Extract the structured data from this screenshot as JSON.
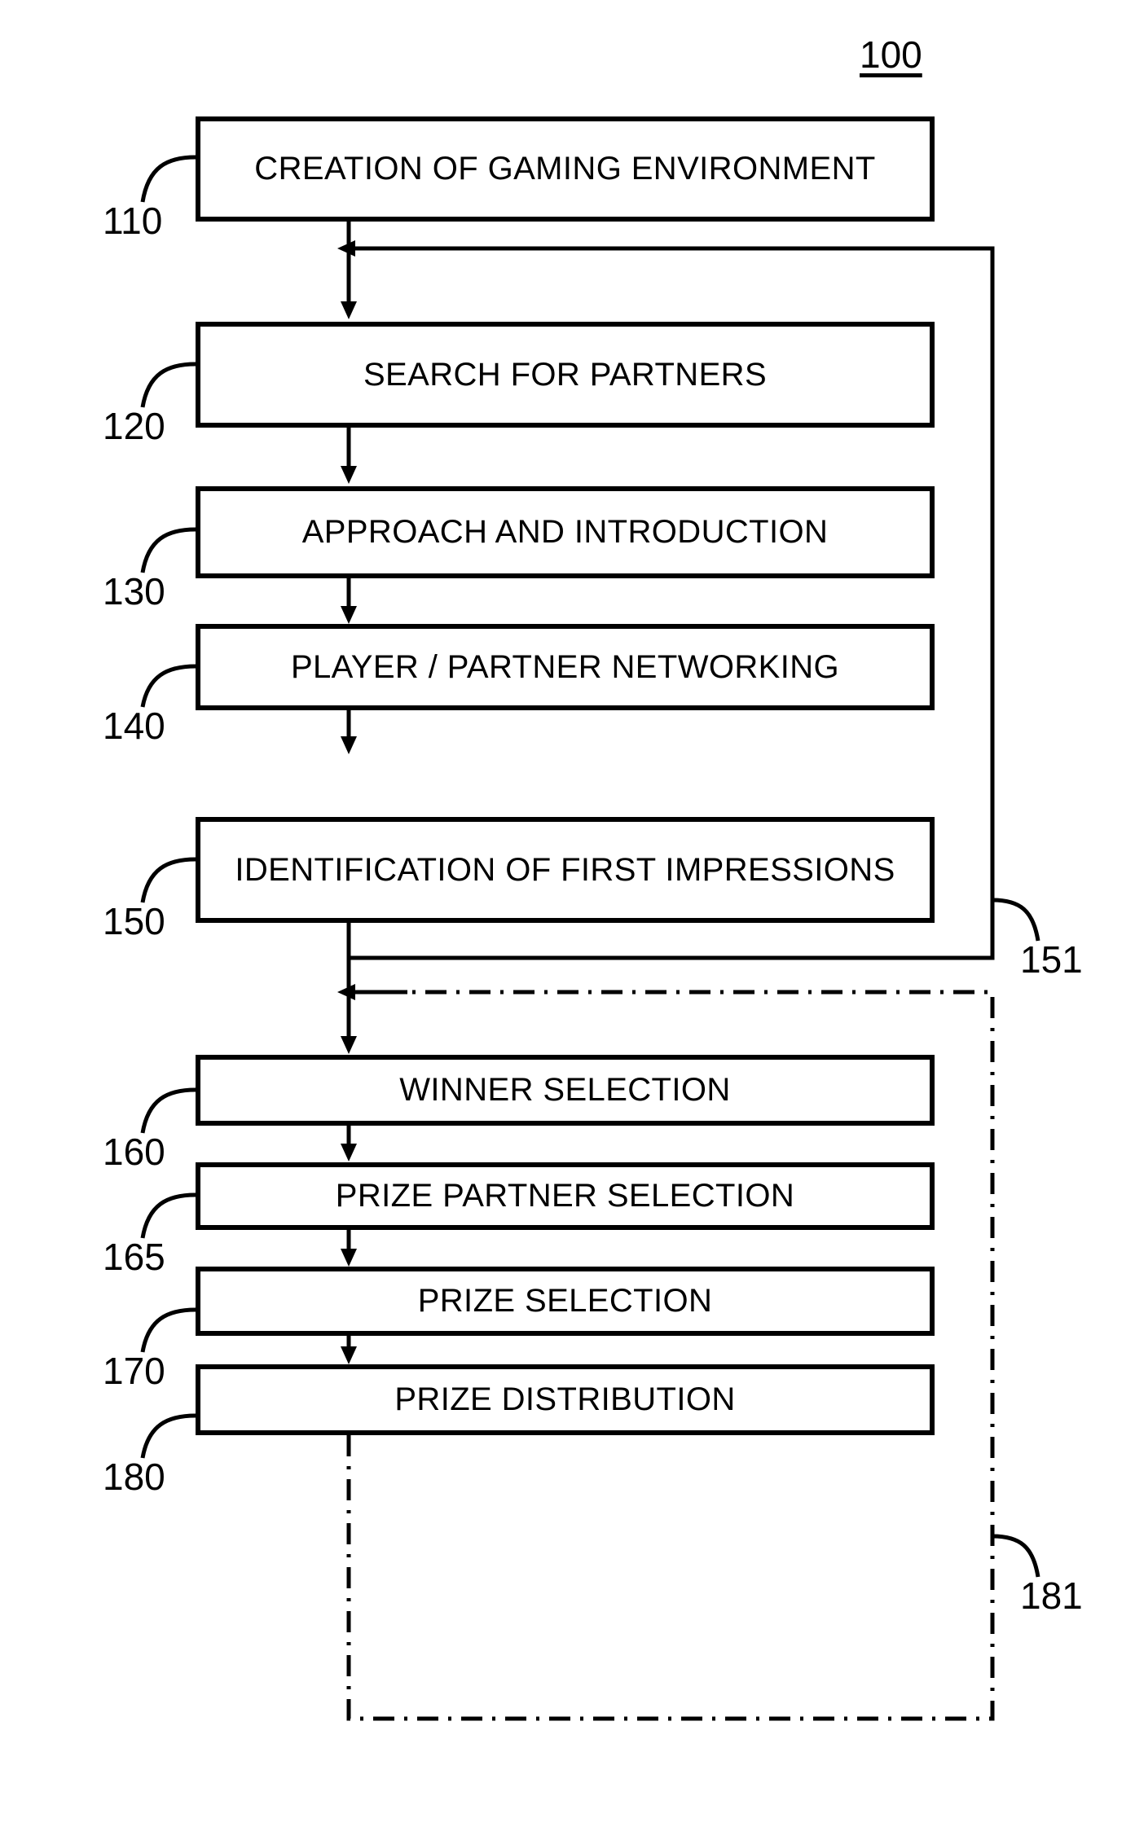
{
  "figure": {
    "figure_number": "100",
    "type": "patent-flowchart",
    "background_color": "#ffffff",
    "line_color": "#000000"
  },
  "nodes": [
    {
      "ref": "110",
      "label": "CREATION OF GAMING ENVIRONMENT"
    },
    {
      "ref": "120",
      "label": "SEARCH FOR PARTNERS"
    },
    {
      "ref": "130",
      "label": "APPROACH AND INTRODUCTION"
    },
    {
      "ref": "140",
      "label": "PLAYER / PARTNER NETWORKING"
    },
    {
      "ref": "150",
      "label": "IDENTIFICATION OF FIRST IMPRESSIONS"
    },
    {
      "ref": "160",
      "label": "WINNER SELECTION"
    },
    {
      "ref": "165",
      "label": "PRIZE PARTNER SELECTION"
    },
    {
      "ref": "170",
      "label": "PRIZE SELECTION"
    },
    {
      "ref": "180",
      "label": "PRIZE DISTRIBUTION"
    }
  ],
  "feedback_paths": [
    {
      "ref": "151",
      "style": "solid",
      "from": "150",
      "to": "120"
    },
    {
      "ref": "181",
      "style": "dash-dot",
      "from": "180",
      "to": "160"
    }
  ]
}
